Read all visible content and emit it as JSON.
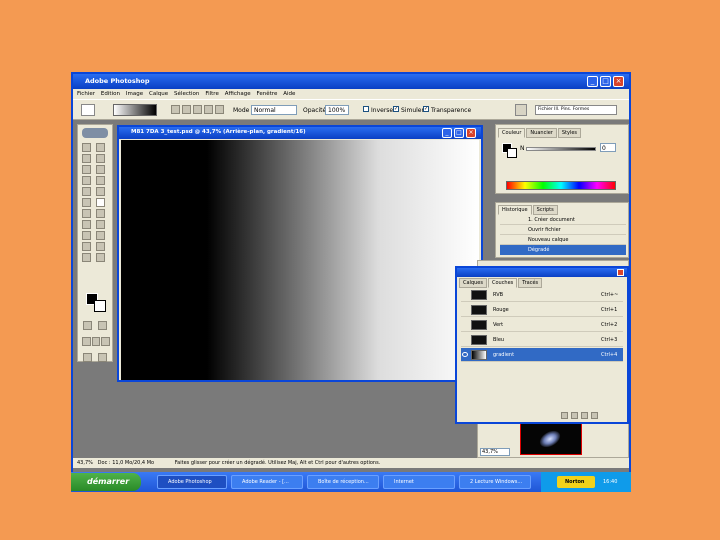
{
  "window": {
    "title": "Adobe Photoshop",
    "menu": [
      "Fichier",
      "Edition",
      "Image",
      "Calque",
      "Sélection",
      "Filtre",
      "Affichage",
      "Fenêtre",
      "Aide"
    ],
    "options": {
      "mode_label": "Mode :",
      "mode_value": "Normal",
      "opacity_label": "Opacité :",
      "opacity_value": "100%",
      "inverse_label": "Inverser",
      "simulate_label": "Simuler",
      "transparency_label": "Transparence",
      "workspace_label": "Fichier   Ill. Pins.   Formes"
    }
  },
  "document": {
    "title": "M81 7DA 3_test.psd @ 43,7% (Arrière-plan, gradient/16)"
  },
  "color_panel": {
    "tabs": [
      "Couleur",
      "Nuancier",
      "Styles"
    ],
    "channel_label": "N",
    "value": "0"
  },
  "history_panel": {
    "tabs": [
      "Historique",
      "Scripts"
    ],
    "items": [
      "1. Créer document",
      "Ouvrir fichier",
      "Nouveau calque",
      "Dégradé"
    ]
  },
  "layers_panel": {
    "tabs": [
      "Calques",
      "Couches",
      "Tracés"
    ],
    "rows": [
      {
        "name": "RVB",
        "shortcut": "Ctrl+~"
      },
      {
        "name": "Rouge",
        "shortcut": "Ctrl+1"
      },
      {
        "name": "Vert",
        "shortcut": "Ctrl+2"
      },
      {
        "name": "Bleu",
        "shortcut": "Ctrl+3"
      },
      {
        "name": "gradient",
        "shortcut": "Ctrl+4"
      }
    ]
  },
  "navigator": {
    "zoom": "43,7%"
  },
  "status": {
    "zoom": "43,7%",
    "doc": "Doc : 11,0 Mo/20,4 Mo",
    "hint": "Faites glisser pour créer un dégradé. Utilisez Maj, Alt et Ctrl pour d'autres options."
  },
  "taskbar": {
    "start_label": "démarrer",
    "tasks": [
      "Adobe Photoshop",
      "Adobe Reader - [...",
      "Boîte de réception...",
      "Internet",
      "2 Lecture Windows..."
    ],
    "notification": "Norton",
    "clock": "16:40"
  }
}
